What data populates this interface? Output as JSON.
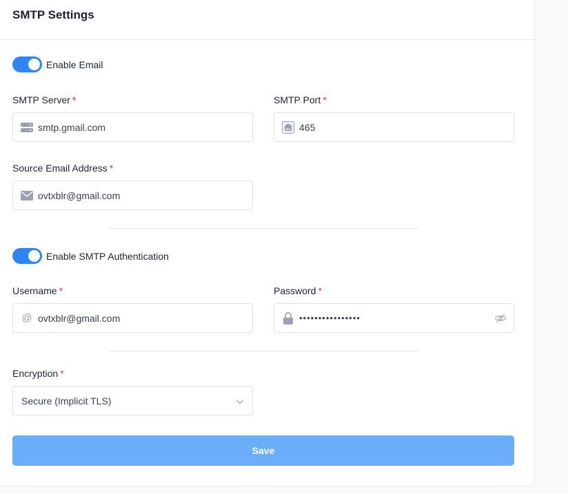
{
  "card": {
    "title": "SMTP Settings"
  },
  "enable_email": {
    "label": "Enable Email",
    "on": true
  },
  "smtp_server": {
    "label": "SMTP Server",
    "required": "*",
    "value": "smtp.gmail.com",
    "icon": "server-icon"
  },
  "smtp_port": {
    "label": "SMTP Port",
    "required": "*",
    "value": "465",
    "icon": "ethernet-port-icon"
  },
  "source_email": {
    "label": "Source Email Address",
    "required": "*",
    "value": "ovtxblr@gmail.com",
    "icon": "envelope-icon"
  },
  "enable_auth": {
    "label": "Enable SMTP Authentication",
    "on": true
  },
  "username": {
    "label": "Username",
    "required": "*",
    "value": "ovtxblr@gmail.com",
    "icon": "at-icon"
  },
  "password": {
    "label": "Password",
    "required": "*",
    "value": "••••••••••••••••",
    "icon": "lock-icon"
  },
  "encryption": {
    "label": "Encryption",
    "required": "*",
    "selected": "Secure (Implicit TLS)"
  },
  "save": {
    "label": "Save"
  },
  "colors": {
    "accent": "#2e85f5",
    "save_button": "#6aaefa",
    "required": "#e0344d"
  }
}
